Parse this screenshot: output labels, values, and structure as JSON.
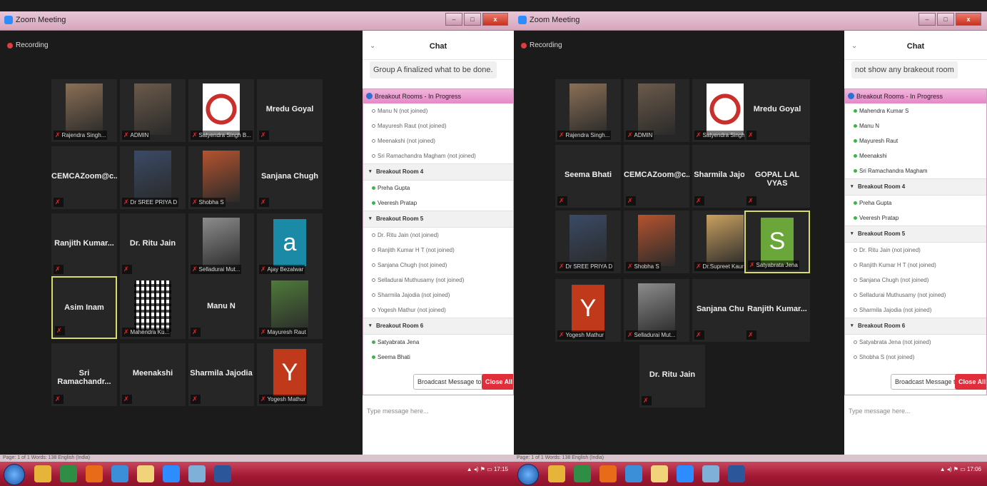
{
  "left": {
    "window_title": "Zoom Meeting",
    "recording": "Recording",
    "tiles": [
      {
        "label": "Rajendra Singh...",
        "kind": "photo",
        "color": "#8a6f55"
      },
      {
        "label": "ADMIN",
        "kind": "photo",
        "color": "#6b5a4a"
      },
      {
        "label": "Satyendra Singh B...",
        "kind": "logo",
        "color": "#c9302c"
      },
      {
        "name": "Mredu Goyal",
        "label": ""
      },
      {
        "name": "CEMCAZoom@c...",
        "label": ""
      },
      {
        "label": "Dr SREE PRIYA D",
        "kind": "photo",
        "color": "#3a4a66"
      },
      {
        "label": "Shobha S",
        "kind": "photo",
        "color": "#b5532f"
      },
      {
        "name": "Sanjana Chugh",
        "label": ""
      },
      {
        "name": "Ranjith Kumar...",
        "label": ""
      },
      {
        "name": "Dr. Ritu Jain",
        "label": ""
      },
      {
        "label": "Selladurai Mut...",
        "kind": "photo",
        "color": "#8c8c8c"
      },
      {
        "label": "Ajay Bezalwar",
        "kind": "avatar",
        "letter": "a",
        "color": "#1b8aa6"
      },
      {
        "name": "Asim Inam",
        "label": "",
        "active": true
      },
      {
        "label": "Mahendra Ku...",
        "kind": "qr",
        "color": "#ffffff"
      },
      {
        "name": "Manu N",
        "label": ""
      },
      {
        "label": "Mayuresh Raut",
        "kind": "photo",
        "color": "#4f7a3a"
      },
      {
        "name": "Sri Ramachandr...",
        "label": ""
      },
      {
        "name": "Meenakshi",
        "label": ""
      },
      {
        "name": "Sharmila Jajodia",
        "label": ""
      },
      {
        "label": "Yogesh Mathur",
        "kind": "avatar",
        "letter": "Y",
        "color": "#c0391b"
      }
    ],
    "chat": {
      "title": "Chat",
      "message": "Group A finalized what to be done.",
      "input_placeholder": "Type message here..."
    },
    "breakout": {
      "title": "Breakout Rooms - In Progress",
      "list": [
        {
          "t": "p",
          "text": "Manu N (not joined)",
          "joined": false
        },
        {
          "t": "p",
          "text": "Mayuresh Raut (not joined)",
          "joined": false
        },
        {
          "t": "p",
          "text": "Meenakshi (not joined)",
          "joined": false
        },
        {
          "t": "p",
          "text": "Sri Ramachandra Magham (not joined)",
          "joined": false
        },
        {
          "t": "r",
          "text": "Breakout Room 4"
        },
        {
          "t": "p",
          "text": "Preha Gupta",
          "joined": true
        },
        {
          "t": "p",
          "text": "Veeresh Pratap",
          "joined": true
        },
        {
          "t": "r",
          "text": "Breakout Room 5"
        },
        {
          "t": "p",
          "text": "Dr. Ritu Jain (not joined)",
          "joined": false
        },
        {
          "t": "p",
          "text": "Ranjith Kumar H T (not joined)",
          "joined": false
        },
        {
          "t": "p",
          "text": "Sanjana Chugh (not joined)",
          "joined": false
        },
        {
          "t": "p",
          "text": "Selladurai Muthusamy (not joined)",
          "joined": false
        },
        {
          "t": "p",
          "text": "Sharmila Jajodia (not joined)",
          "joined": false
        },
        {
          "t": "p",
          "text": "Yogesh Mathur (not joined)",
          "joined": false
        },
        {
          "t": "r",
          "text": "Breakout Room 6"
        },
        {
          "t": "p",
          "text": "Satyabrata Jena",
          "joined": true
        },
        {
          "t": "p",
          "text": "Seema Bhati",
          "joined": true
        }
      ],
      "broadcast": "Broadcast Message to All",
      "close_all": "Close All Ro"
    },
    "clock": "17:15",
    "statusbar": "Page: 1 of 1   Words: 138   English (India)"
  },
  "right": {
    "window_title": "Zoom Meeting",
    "recording": "Recording",
    "tiles": [
      {
        "label": "Rajendra Singh...",
        "kind": "photo",
        "color": "#8a6f55"
      },
      {
        "label": "ADMIN",
        "kind": "photo",
        "color": "#6b5a4a"
      },
      {
        "label": "Satyendra Singh B...",
        "kind": "logo",
        "color": "#c9302c"
      },
      {
        "name": "Mredu Goyal",
        "label": ""
      },
      {
        "name": "Seema Bhati",
        "label": ""
      },
      {
        "name": "CEMCAZoom@c...",
        "label": ""
      },
      {
        "name": "Sharmila Jajodia",
        "label": ""
      },
      {
        "name": "GOPAL LAL VYAS",
        "label": ""
      },
      {
        "label": "Dr SREE PRIYA D",
        "kind": "photo",
        "color": "#3a4a66"
      },
      {
        "label": "Shobha S",
        "kind": "photo",
        "color": "#b5532f"
      },
      {
        "label": "Dr.Supreet Kaur",
        "kind": "photo",
        "color": "#c9a060"
      },
      {
        "label": "Satyabrata Jena",
        "kind": "avatar",
        "letter": "S",
        "color": "#6aa63a",
        "active": true
      },
      {
        "label": "Yogesh Mathur",
        "kind": "avatar",
        "letter": "Y",
        "color": "#c0391b"
      },
      {
        "label": "Selladurai Mut...",
        "kind": "photo",
        "color": "#8c8c8c"
      },
      {
        "name": "Sanjana Chugh",
        "label": ""
      },
      {
        "name": "Ranjith Kumar...",
        "label": ""
      },
      {
        "name": "Dr. Ritu Jain",
        "label": ""
      }
    ],
    "chat": {
      "title": "Chat",
      "message": "not show any brakeout room",
      "input_placeholder": "Type message here..."
    },
    "breakout": {
      "title": "Breakout Rooms - In Progress",
      "list": [
        {
          "t": "p",
          "text": "Mahendra Kumar S",
          "joined": true
        },
        {
          "t": "p",
          "text": "Manu N",
          "joined": true
        },
        {
          "t": "p",
          "text": "Mayuresh Raut",
          "joined": true
        },
        {
          "t": "p",
          "text": "Meenakshi",
          "joined": true
        },
        {
          "t": "p",
          "text": "Sri Ramachandra Magham",
          "joined": true
        },
        {
          "t": "r",
          "text": "Breakout Room 4"
        },
        {
          "t": "p",
          "text": "Preha Gupta",
          "joined": true
        },
        {
          "t": "p",
          "text": "Veeresh Pratap",
          "joined": true
        },
        {
          "t": "r",
          "text": "Breakout Room 5"
        },
        {
          "t": "p",
          "text": "Dr. Ritu Jain (not joined)",
          "joined": false
        },
        {
          "t": "p",
          "text": "Ranjith Kumar H T (not joined)",
          "joined": false
        },
        {
          "t": "p",
          "text": "Sanjana Chugh (not joined)",
          "joined": false
        },
        {
          "t": "p",
          "text": "Selladurai Muthusamy (not joined)",
          "joined": false
        },
        {
          "t": "p",
          "text": "Sharmila Jajodia (not joined)",
          "joined": false
        },
        {
          "t": "r",
          "text": "Breakout Room 6"
        },
        {
          "t": "p",
          "text": "Satyabrata Jena (not joined)",
          "joined": false
        },
        {
          "t": "p",
          "text": "Shobha S (not joined)",
          "joined": false
        }
      ],
      "broadcast": "Broadcast Message to All",
      "close_all": "Close All Ro"
    },
    "clock": "17:06",
    "statusbar": "Page: 1 of 1   Words: 138   English (India)"
  },
  "taskbar_icons": [
    {
      "name": "explorer-icon",
      "color": "#e7b43a"
    },
    {
      "name": "chrome-icon",
      "color": "#2f8d45"
    },
    {
      "name": "firefox-icon",
      "color": "#e86b1a"
    },
    {
      "name": "ie-icon",
      "color": "#3b8fd9"
    },
    {
      "name": "folder-icon",
      "color": "#f2d27a"
    },
    {
      "name": "zoom-icon",
      "color": "#2d8cff"
    },
    {
      "name": "app-icon",
      "color": "#7fb0d8"
    },
    {
      "name": "word-icon",
      "color": "#2b579a"
    }
  ]
}
